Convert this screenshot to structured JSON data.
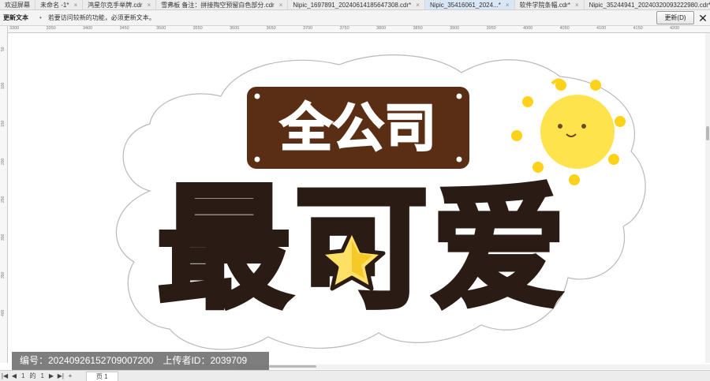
{
  "tabs": [
    {
      "label": "欢迎屏幕",
      "active": false
    },
    {
      "label": "未命名 -1*",
      "active": false
    },
    {
      "label": "鸿星尔克手举牌.cdr",
      "active": false
    },
    {
      "label": "雪弗板 备注：拼接掏空预留白色部分.cdr",
      "active": false
    },
    {
      "label": "Nipic_1697891_20240614185647308.cdr*",
      "active": false
    },
    {
      "label": "Nipic_35416061_2024...*",
      "active": true
    },
    {
      "label": "软件学院条幅.cdr*",
      "active": false
    },
    {
      "label": "Nipic_35244941_20240320093222980.cdr*",
      "active": false
    }
  ],
  "tab_close_glyph": "×",
  "notification": {
    "title": "更新文本",
    "separator": "•",
    "message": "若要访问较新的功能，必须更新文本。",
    "update_button": "更新(D)",
    "close_glyph": "✕"
  },
  "ruler": {
    "h_labels": [
      "3300",
      "3350",
      "3400",
      "3450",
      "3500",
      "3550",
      "3600",
      "3650",
      "3700",
      "3750",
      "3800",
      "3850",
      "3900",
      "3950",
      "4000",
      "4050",
      "4100",
      "4150",
      "4200"
    ],
    "v_labels": [
      "50",
      "100",
      "150",
      "200",
      "250",
      "300",
      "350",
      "400"
    ]
  },
  "artwork": {
    "label_text": "全公司",
    "main_text": "最可爱",
    "colors": {
      "brown": "#5a2e14",
      "dark": "#2a1c15",
      "sun": "#ffe34d",
      "sun_ray": "#ffd21a",
      "star": "#ffe066",
      "outline": "#b9b9b9"
    }
  },
  "watermark": "编号：20240926152709007200　上传者ID：2039709",
  "page_nav": {
    "first": "|◀",
    "prev": "◀",
    "current": "1",
    "of": "的",
    "total": "1",
    "next": "▶",
    "last": "▶|",
    "add": "+",
    "page_tab": "页 1"
  }
}
